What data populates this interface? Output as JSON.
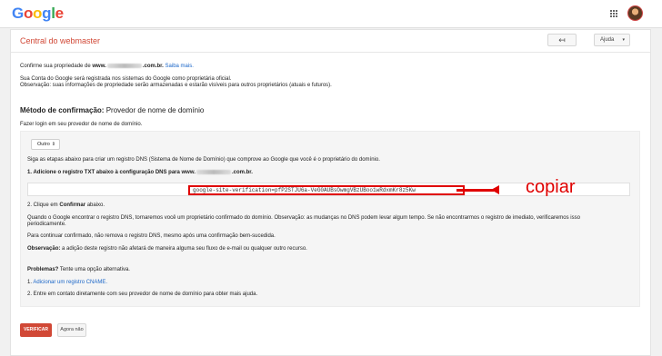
{
  "app": {
    "logo_letters": [
      {
        "ch": "G",
        "color": "#4285f4"
      },
      {
        "ch": "o",
        "color": "#ea4335"
      },
      {
        "ch": "o",
        "color": "#fbbc05"
      },
      {
        "ch": "g",
        "color": "#4285f4"
      },
      {
        "ch": "l",
        "color": "#34a853"
      },
      {
        "ch": "e",
        "color": "#ea4335"
      }
    ]
  },
  "header": {
    "title": "Central do webmaster",
    "back_icon": "↤",
    "help_label": "Ajuda",
    "help_caret": "▾"
  },
  "intro": {
    "confirm_prefix": "Confirme sua propriedade de ",
    "domain_start": "www.",
    "domain_end": ".com.br.",
    "learn_more": "Saiba mais.",
    "line2": "Sua Conta do Google será registrada nos sistemas do Google como proprietária oficial.",
    "line3": "Observação: suas informações de propriedade serão armazenadas e estarão visíveis para outros proprietários (atuais e futuros)."
  },
  "method": {
    "label": "Método de confirmação:",
    "value": "Provedor de nome de domínio",
    "subtitle": "Fazer login em seu provedor de nome de domínio."
  },
  "panel": {
    "select_value": "Outro",
    "select_arrows": "⇕",
    "step_intro": "Siga as etapas abaixo para criar um registro DNS (Sistema de Nome de Domínio) que comprove ao Google que você é o proprietário do domínio.",
    "step1_prefix": "1. ",
    "step1_bold": "Adicione",
    "step1_text": " o registro TXT abaixo à configuração DNS para ",
    "step1_domain_start": "www.",
    "step1_domain_end": ".com.br.",
    "txt_record": "google-site-verification=pfP2STJU6a-VeG0AUBsOwmgVBzUBoo1wRdxmKr8z5Kw",
    "step2_prefix": "2. Clique em ",
    "step2_bold": "Confirmar",
    "step2_suffix": " abaixo.",
    "note1": "Quando o Google encontrar o registro DNS, tornaremos você um proprietário confirmado do domínio. Observação: as mudanças no DNS podem levar algum tempo. Se não encontrarmos o registro de imediato, verificaremos isso",
    "note1b": "periodicamente.",
    "note2": "Para continuar confirmado, não remova o registro DNS, mesmo após uma confirmação bem-sucedida.",
    "obs_label": "Observação:",
    "obs_text": " a adição deste registro não afetará de maneira alguma seu fluxo de e-mail ou qualquer outro recurso.",
    "problems_label": "Problemas?",
    "problems_text": " Tente uma opção alternativa.",
    "alt1_prefix": "1. ",
    "alt1_link": "Adicionar um registro CNAME.",
    "alt2": "2. Entre em contato diretamente com seu provedor de nome de domínio para obter mais ajuda."
  },
  "annotation": {
    "text": "copiar",
    "color": "#e00000"
  },
  "actions": {
    "verify": "VERIFICAR",
    "later": "Agora não"
  }
}
